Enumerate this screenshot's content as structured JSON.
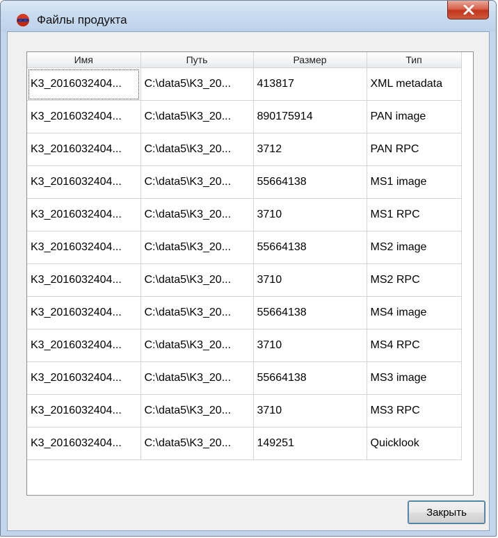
{
  "window": {
    "title": "Файлы продукта",
    "icon": "app-logo-icon",
    "close_icon": "close-x-icon"
  },
  "table": {
    "columns": [
      "Имя",
      "Путь",
      "Размер",
      "Тип"
    ],
    "rows": [
      [
        "K3_2016032404...",
        "C:\\data5\\K3_20...",
        "413817",
        "XML metadata"
      ],
      [
        "K3_2016032404...",
        "C:\\data5\\K3_20...",
        "890175914",
        "PAN image"
      ],
      [
        "K3_2016032404...",
        "C:\\data5\\K3_20...",
        "3712",
        "PAN RPC"
      ],
      [
        "K3_2016032404...",
        "C:\\data5\\K3_20...",
        "55664138",
        "MS1 image"
      ],
      [
        "K3_2016032404...",
        "C:\\data5\\K3_20...",
        "3710",
        "MS1 RPC"
      ],
      [
        "K3_2016032404...",
        "C:\\data5\\K3_20...",
        "55664138",
        "MS2 image"
      ],
      [
        "K3_2016032404...",
        "C:\\data5\\K3_20...",
        "3710",
        "MS2 RPC"
      ],
      [
        "K3_2016032404...",
        "C:\\data5\\K3_20...",
        "55664138",
        "MS4 image"
      ],
      [
        "K3_2016032404...",
        "C:\\data5\\K3_20...",
        "3710",
        "MS4 RPC"
      ],
      [
        "K3_2016032404...",
        "C:\\data5\\K3_20...",
        "55664138",
        "MS3 image"
      ],
      [
        "K3_2016032404...",
        "C:\\data5\\K3_20...",
        "3710",
        "MS3 RPC"
      ],
      [
        "K3_2016032404...",
        "C:\\data5\\K3_20...",
        "149251",
        "Quicklook"
      ]
    ]
  },
  "buttons": {
    "close_label": "Закрыть"
  }
}
